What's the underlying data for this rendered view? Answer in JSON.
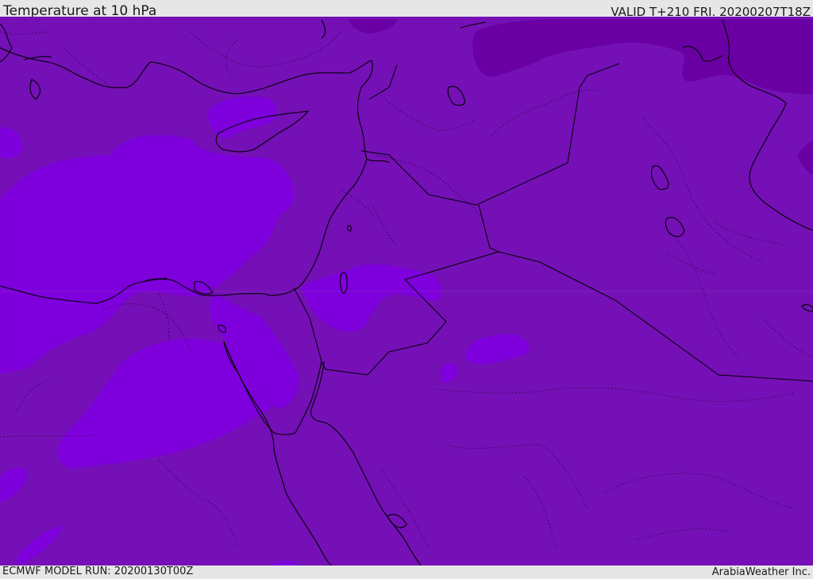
{
  "header": {
    "title": "Temperature at 10 hPa",
    "valid_time": "VALID T+210 FRI. 20200207T18Z"
  },
  "footer": {
    "model_run": "ECMWF MODEL RUN: 20200130T00Z",
    "brand": "ArabiaWeather Inc."
  },
  "map": {
    "field_colors": {
      "base": "#7410b6",
      "warm_band": "#7e00dc",
      "cold_band": "#6a00a4",
      "coast": "#000000"
    }
  }
}
